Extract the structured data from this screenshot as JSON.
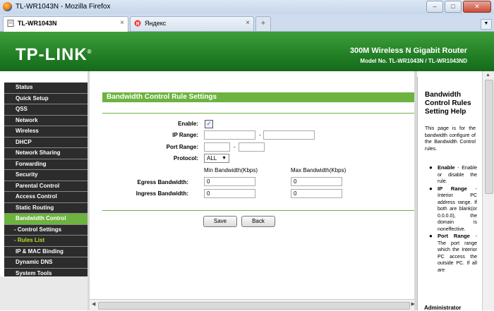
{
  "window": {
    "title": "TL-WR1043N - Mozilla Firefox",
    "minimize": "–",
    "maximize": "□",
    "close": "✕"
  },
  "tabs": [
    {
      "label": "TL-WR1043N",
      "close": "×"
    },
    {
      "label": "Яндекс",
      "close": "×"
    }
  ],
  "new_tab": "+",
  "banner": {
    "logo": "TP-LINK",
    "logo_mark": "®",
    "product": "300M Wireless N Gigabit Router",
    "model": "Model No. TL-WR1043N / TL-WR1043ND"
  },
  "sidebar": {
    "items": [
      "Status",
      "Quick Setup",
      "QSS",
      "Network",
      "Wireless",
      "DHCP",
      "Network Sharing",
      "Forwarding",
      "Security",
      "Parental Control",
      "Access Control",
      "Static Routing",
      "Bandwidth Control",
      "- Control Settings",
      "- Rules List",
      "IP & MAC Binding",
      "Dynamic DNS",
      "System Tools"
    ]
  },
  "form": {
    "title": "Bandwidth Control Rule Settings",
    "enable_label": "Enable:",
    "enable_check": "✓",
    "ip_range_label": "IP Range:",
    "port_range_label": "Port Range:",
    "protocol_label": "Protocol:",
    "protocol_value": "ALL",
    "dash": "-",
    "min_head": "Min Bandwidth(Kbps)",
    "max_head": "Max Bandwidth(Kbps)",
    "egress_label": "Egress Bandwidth:",
    "ingress_label": "Ingress Bandwidth:",
    "egress_min": "0",
    "egress_max": "0",
    "ingress_min": "0",
    "ingress_max": "0",
    "save": "Save",
    "back": "Back"
  },
  "help": {
    "title": "Bandwidth Control Rules Setting Help",
    "intro": "This page is for the bandwidth configure of the Bandwidth Control rules.",
    "items": [
      {
        "term": "Enable",
        "desc": " - Enable or disable the rule."
      },
      {
        "term": "IP Range",
        "desc": " - Interior PC address range. If both are blank(or 0.0.0.0), the domain is noneffective."
      },
      {
        "term": "Port Range",
        "desc": " - The port range which the Interior PC access the outside PC. If all are"
      }
    ],
    "footer": "Administrator"
  }
}
